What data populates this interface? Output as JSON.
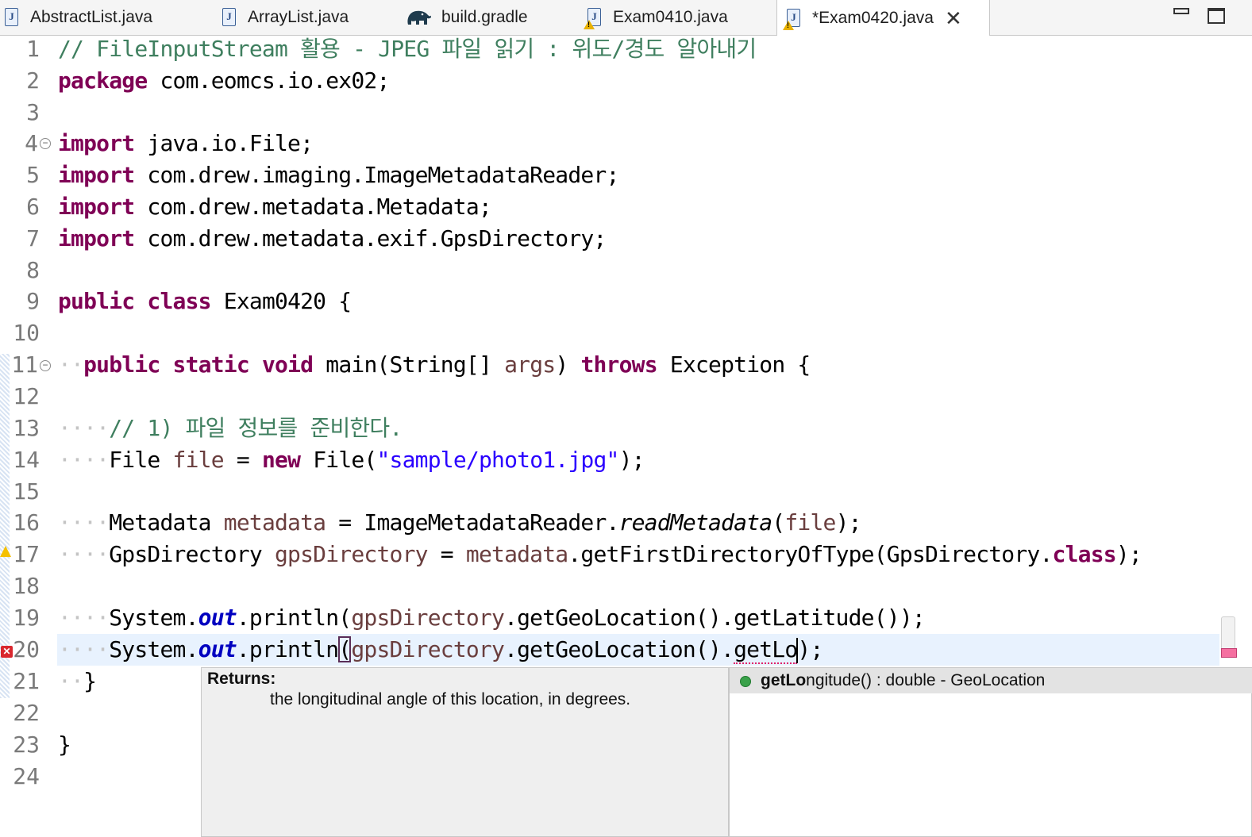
{
  "tabs": [
    {
      "label": "AbstractList.java",
      "icon": "java-file-icon"
    },
    {
      "label": "ArrayList.java",
      "icon": "java-file-icon"
    },
    {
      "label": "build.gradle",
      "icon": "gradle-elephant-icon"
    },
    {
      "label": "Exam0410.java",
      "icon": "java-file-warning-icon"
    },
    {
      "label": "*Exam0420.java",
      "icon": "java-file-warning-icon",
      "active": true
    }
  ],
  "window_controls": {
    "minimize": "minimize-icon",
    "maximize": "maximize-icon"
  },
  "editor": {
    "line_numbers": [
      "1",
      "2",
      "3",
      "4",
      "5",
      "6",
      "7",
      "8",
      "9",
      "10",
      "11",
      "12",
      "13",
      "14",
      "15",
      "16",
      "17",
      "18",
      "19",
      "20",
      "21",
      "22",
      "23",
      "24"
    ],
    "lines": {
      "l1": "// FileInputStream 활용 - JPEG 파일 읽기 : 위도/경도 알아내기",
      "l2_kw": "package",
      "l2_rest": "com.eomcs.io.ex02;",
      "l4_kw": "import",
      "l4_rest": "java.io.File;",
      "l5_kw": "import",
      "l5_rest": "com.drew.imaging.ImageMetadataReader;",
      "l6_kw": "import",
      "l6_rest": "com.drew.metadata.Metadata;",
      "l7_kw": "import",
      "l7_rest": "com.drew.metadata.exif.GpsDirectory;",
      "l9_kw1": "public",
      "l9_kw2": "class",
      "l9_rest": "Exam0420 {",
      "l11_kw1": "public",
      "l11_kw2": "static",
      "l11_kw3": "void",
      "l11_a": "main(String[]",
      "l11_var": "args",
      "l11_b": ")",
      "l11_kw4": "throws",
      "l11_c": "Exception {",
      "l13": "// 1) 파일 정보를 준비한다.",
      "l14_a": "File",
      "l14_var": "file",
      "l14_b": "=",
      "l14_kw": "new",
      "l14_c": "File(",
      "l14_str": "\"sample/photo1.jpg\"",
      "l14_d": ");",
      "l16_a": "Metadata",
      "l16_var": "metadata",
      "l16_b": "= ImageMetadataReader.",
      "l16_ital": "readMetadata",
      "l16_c": "(",
      "l16_var2": "file",
      "l16_d": ");",
      "l17_a": "GpsDirectory",
      "l17_var": "gpsDirectory",
      "l17_b": "=",
      "l17_var2": "metadata",
      "l17_c": ".getFirstDirectoryOfType(GpsDirectory.",
      "l17_kw": "class",
      "l17_d": ");",
      "l19_a": "System.",
      "l19_fld": "out",
      "l19_b": ".println(",
      "l19_var": "gpsDirectory",
      "l19_c": ".getGeoLocation().getLatitude());",
      "l20_a": "System.",
      "l20_fld": "out",
      "l20_b": ".println",
      "l20_paren": "(",
      "l20_var": "gpsDirectory",
      "l20_c": ".getGeoLocation().",
      "l20_sq": "getLo",
      "l20_d": ");",
      "l21": "}",
      "l23": "}"
    }
  },
  "javadoc_popup": {
    "title": "Returns:",
    "text": "the longitudinal angle of this location, in degrees."
  },
  "proposal_popup": {
    "items": [
      {
        "match": "getLo",
        "rest": "ngitude() : double - GeoLocation",
        "icon": "public-method-icon"
      }
    ]
  },
  "colors": {
    "keyword": "#7f0055",
    "comment": "#3f7f5f",
    "string": "#2a00ff",
    "field": "#0000c0",
    "variable": "#6a3e3e"
  }
}
